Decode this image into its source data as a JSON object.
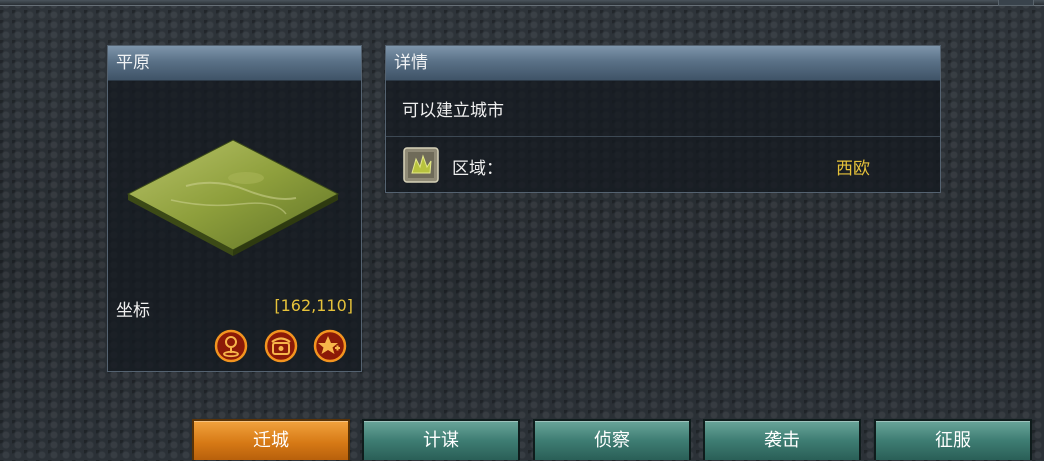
{
  "tile_panel": {
    "title": "平原",
    "coord_label": "坐标",
    "coord_value": "[162,110]"
  },
  "detail_panel": {
    "title": "详情",
    "status": "可以建立城市",
    "region_label": "区域：",
    "region_value": "西欧"
  },
  "actions": {
    "move": "迁城",
    "scheme": "计谋",
    "scout": "侦察",
    "raid": "袭击",
    "conquer": "征服"
  },
  "icons": {
    "locate": "map-pin-icon",
    "phone": "phone-icon",
    "favorite": "star-icon",
    "region": "region-emblem-icon"
  },
  "colors": {
    "highlight": "#e6c23a",
    "active_button": "#d77a16",
    "button": "#3e7d73",
    "header": "#5a7187"
  }
}
